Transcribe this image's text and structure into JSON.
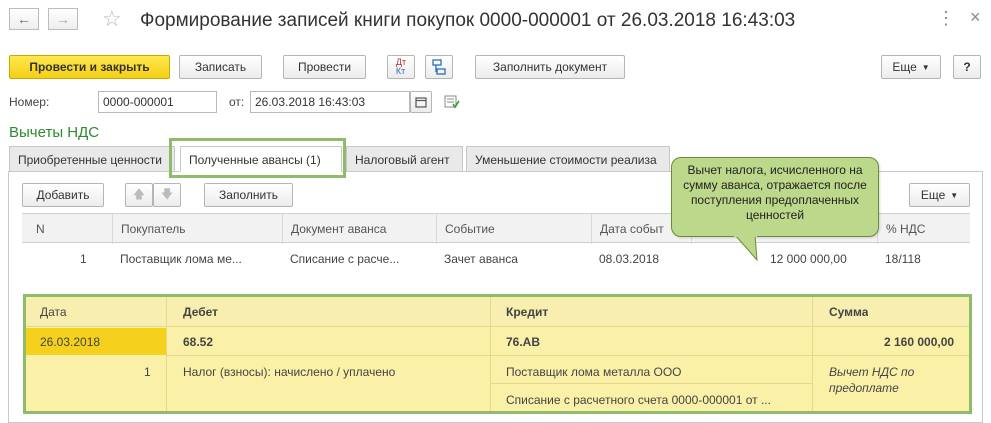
{
  "window": {
    "title": "Формирование записей книги покупок 0000-000001 от 26.03.2018 16:43:03"
  },
  "toolbar": {
    "post_close": "Провести и закрыть",
    "save": "Записать",
    "post": "Провести",
    "dt_kt_top": "Дт",
    "dt_kt_bottom": "Кт",
    "fill_doc": "Заполнить документ",
    "more": "Еще",
    "help": "?"
  },
  "header": {
    "number_label": "Номер:",
    "number_value": "0000-000001",
    "date_label": "от:",
    "date_value": "26.03.2018 16:43:03"
  },
  "section_title": "Вычеты НДС",
  "tabs": [
    {
      "label": "Приобретенные ценности"
    },
    {
      "label": "Полученные авансы (1)"
    },
    {
      "label": "Налоговый агент"
    },
    {
      "label": "Уменьшение стоимости реализа"
    }
  ],
  "grid_toolbar": {
    "add": "Добавить",
    "fill": "Заполнить",
    "more": "Еще"
  },
  "table": {
    "columns": [
      "N",
      "Покупатель",
      "Документ аванса",
      "Событие",
      "Дата событ",
      "",
      "% НДС"
    ],
    "rows": [
      {
        "n": "1",
        "buyer": "Поставщик лома ме...",
        "doc": "Списание с расче...",
        "event": "Зачет аванса",
        "date": "08.03.2018",
        "amount": "12 000 000,00",
        "vat": "18/118"
      }
    ]
  },
  "postings": {
    "columns": [
      "Дата",
      "Дебет",
      "Кредит",
      "Сумма"
    ],
    "row": {
      "date": "26.03.2018",
      "debit": "68.52",
      "credit": "76.АВ",
      "sum": "2 160 000,00",
      "line_no": "1",
      "debit_sub": "Налог (взносы): начислено / уплачено",
      "credit_sub1": "Поставщик лома металла ООО",
      "credit_sub2": "Списание с расчетного счета 0000-000001 от ...",
      "sum_note1": "Вычет НДС по",
      "sum_note2": "предоплате"
    }
  },
  "callout": {
    "text": "Вычет налога, исчисленного на сумму аванса, отражается после поступления предоплаченных ценностей"
  },
  "colors": {
    "accent_green": "#2e8a2e",
    "highlight_yellow": "#fbf0a8",
    "primary_button": "#f5cf16",
    "annotation_border": "#8fbc6a"
  }
}
